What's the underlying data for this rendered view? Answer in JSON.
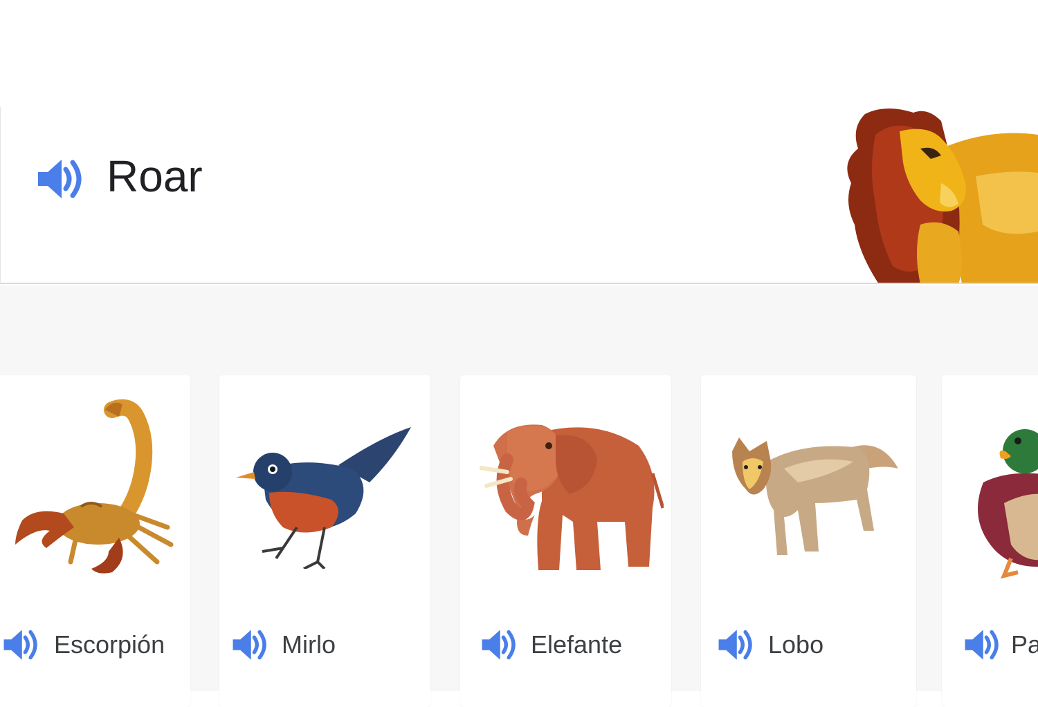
{
  "hero": {
    "title": "Roar",
    "speaker_icon": "speaker-icon",
    "image_icon": "lion-illustration"
  },
  "cards": [
    {
      "label": "Escorpión",
      "icon": "scorpion-illustration"
    },
    {
      "label": "Mirlo",
      "icon": "blackbird-illustration"
    },
    {
      "label": "Elefante",
      "icon": "elephant-illustration"
    },
    {
      "label": "Lobo",
      "icon": "wolf-illustration"
    },
    {
      "label": "Pa",
      "icon": "duck-illustration"
    }
  ],
  "colors": {
    "speaker_blue": "#4a7ee8",
    "text_dark": "#202124",
    "text_label": "#3c4043",
    "background_grey": "#f7f7f7"
  }
}
